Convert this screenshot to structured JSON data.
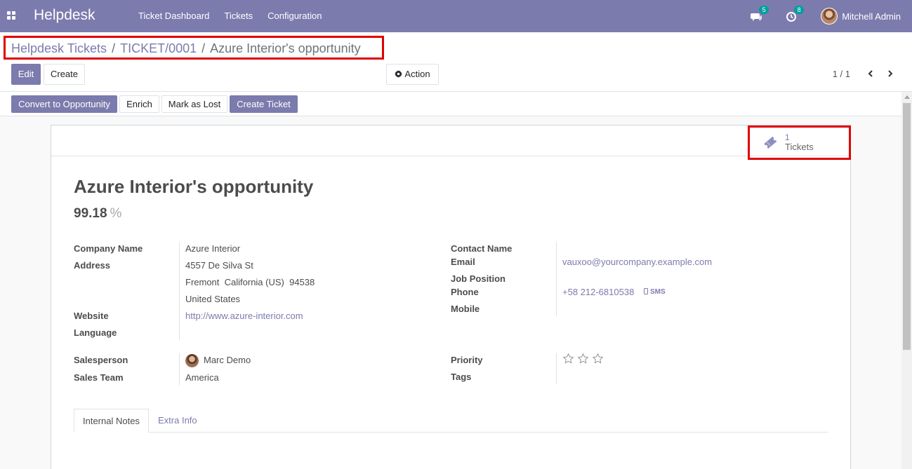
{
  "navbar": {
    "brand": "Helpdesk",
    "menu": [
      "Ticket Dashboard",
      "Tickets",
      "Configuration"
    ],
    "messages_count": "5",
    "activities_count": "8",
    "user_name": "Mitchell Admin"
  },
  "breadcrumb": {
    "root": "Helpdesk Tickets",
    "ticket": "TICKET/0001",
    "current": "Azure Interior's opportunity",
    "separator": "/"
  },
  "toolbar": {
    "edit_label": "Edit",
    "create_label": "Create",
    "action_label": "Action",
    "pager": "1 / 1"
  },
  "statusbar": {
    "convert_label": "Convert to Opportunity",
    "enrich_label": "Enrich",
    "lost_label": "Mark as Lost",
    "create_ticket_label": "Create Ticket"
  },
  "smart_button": {
    "count": "1",
    "label": "Tickets"
  },
  "record": {
    "title": "Azure Interior's opportunity",
    "probability": "99.18",
    "probability_unit": "%"
  },
  "left_fields": {
    "company_label": "Company Name",
    "company_value": "Azure Interior",
    "address_label": "Address",
    "address_line1": "4557 De Silva St",
    "address_line2": "Fremont  California (US)  94538",
    "address_line3": "United States",
    "website_label": "Website",
    "website_value": "http://www.azure-interior.com",
    "language_label": "Language"
  },
  "right_fields": {
    "contact_label": "Contact Name",
    "email_label": "Email",
    "email_value": "vauxoo@yourcompany.example.com",
    "job_label": "Job Position",
    "phone_label": "Phone",
    "phone_value": "+58 212-6810538",
    "sms_label": "SMS",
    "mobile_label": "Mobile"
  },
  "lower_fields": {
    "salesperson_label": "Salesperson",
    "salesperson_value": "Marc Demo",
    "team_label": "Sales Team",
    "team_value": "America",
    "priority_label": "Priority",
    "priority_level": 0,
    "priority_max": 3,
    "tags_label": "Tags"
  },
  "tabs": [
    "Internal Notes",
    "Extra Info"
  ],
  "colors": {
    "brand": "#7c7bad",
    "highlight": "#e00000",
    "badge": "#00a09d"
  }
}
